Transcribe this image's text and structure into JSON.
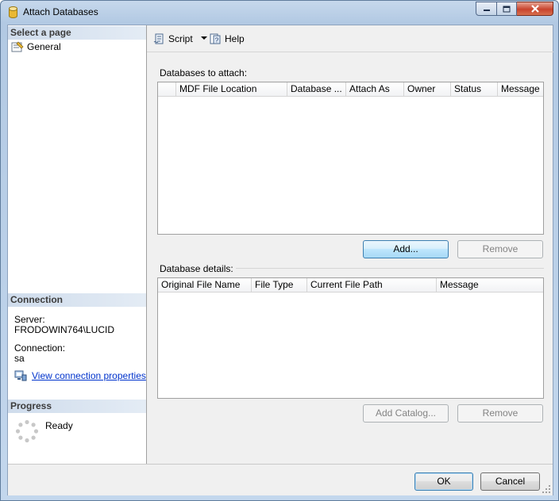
{
  "window": {
    "title": "Attach Databases",
    "controls": {
      "minimize_icon": "minimize-icon",
      "maximize_icon": "maximize-icon",
      "close_icon": "close-icon"
    }
  },
  "left_panel": {
    "select_page_header": "Select a page",
    "pages": [
      {
        "label": "General",
        "icon": "general-page-icon"
      }
    ],
    "connection_header": "Connection",
    "server_label": "Server:",
    "server_value": "FRODOWIN764\\LUCID",
    "connection_label": "Connection:",
    "connection_value": "sa",
    "view_props_link": "View connection properties",
    "progress_header": "Progress",
    "progress_status": "Ready"
  },
  "toolbar": {
    "script_label": "Script",
    "help_label": "Help"
  },
  "databases_to_attach": {
    "label": "Databases to attach:",
    "columns": [
      "",
      "MDF File Location",
      "Database ...",
      "Attach As",
      "Owner",
      "Status",
      "Message"
    ],
    "rows": [],
    "add_button": "Add...",
    "remove_button": "Remove"
  },
  "database_details": {
    "label": "Database details:",
    "columns": [
      "Original File Name",
      "File Type",
      "Current File Path",
      "Message"
    ],
    "rows": [],
    "add_catalog_button": "Add Catalog...",
    "remove_button": "Remove"
  },
  "footer": {
    "ok_button": "OK",
    "cancel_button": "Cancel"
  },
  "colors": {
    "section_header_bg": "#cfdcec",
    "link": "#0033cc",
    "disabled_text": "#838383",
    "close_button": "#c8442d"
  }
}
